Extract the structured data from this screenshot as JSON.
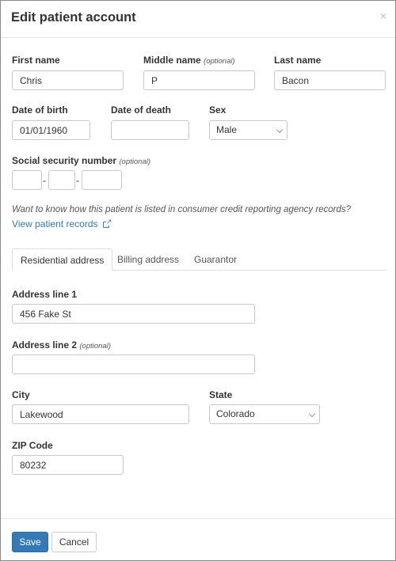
{
  "modal": {
    "title": "Edit patient account",
    "close_glyph": "×"
  },
  "optional_text": "(optional)",
  "fields": {
    "first_name": {
      "label": "First name",
      "value": "Chris"
    },
    "middle_name": {
      "label": "Middle name",
      "value": "P"
    },
    "last_name": {
      "label": "Last name",
      "value": "Bacon"
    },
    "date_of_birth": {
      "label": "Date of birth",
      "value": "01/01/1960"
    },
    "date_of_death": {
      "label": "Date of death",
      "value": ""
    },
    "sex": {
      "label": "Sex",
      "selected": "Male"
    },
    "ssn": {
      "label": "Social security number",
      "part1": "",
      "part2": "",
      "part3": "",
      "separator": "-"
    }
  },
  "credit_help": {
    "text": "Want to know how this patient is listed in consumer credit reporting agency records?",
    "link_label": "View patient records",
    "link_icon": "external-link-icon"
  },
  "tabs": [
    {
      "label": "Residential address",
      "active": true
    },
    {
      "label": "Billing address",
      "active": false
    },
    {
      "label": "Guarantor",
      "active": false
    }
  ],
  "address": {
    "line1": {
      "label": "Address line 1",
      "value": "456 Fake St"
    },
    "line2": {
      "label": "Address line 2",
      "value": ""
    },
    "city": {
      "label": "City",
      "value": "Lakewood"
    },
    "state": {
      "label": "State",
      "selected": "Colorado"
    },
    "zip": {
      "label": "ZIP Code",
      "value": "80232"
    }
  },
  "footer": {
    "save_label": "Save",
    "cancel_label": "Cancel"
  },
  "colors": {
    "primary": "#337ab7",
    "link": "#337ab7",
    "border": "#c8c8c8"
  }
}
